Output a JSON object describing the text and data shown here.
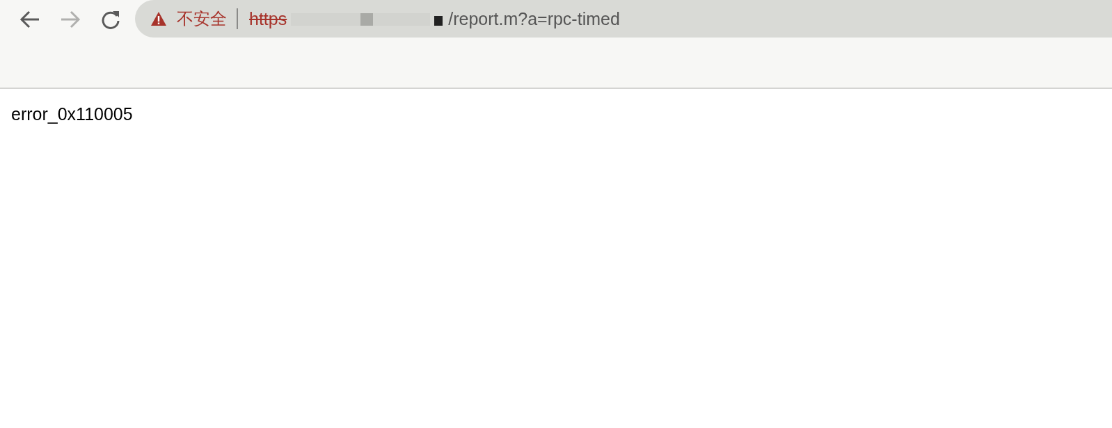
{
  "toolbar": {
    "back": {
      "disabled": false
    },
    "forward": {
      "disabled": true
    }
  },
  "address_bar": {
    "security_label": "不安全",
    "scheme": "https",
    "scheme_struck": true,
    "path": "/report.m?a=rpc-timed"
  },
  "page": {
    "body_text": "error_0x110005"
  }
}
